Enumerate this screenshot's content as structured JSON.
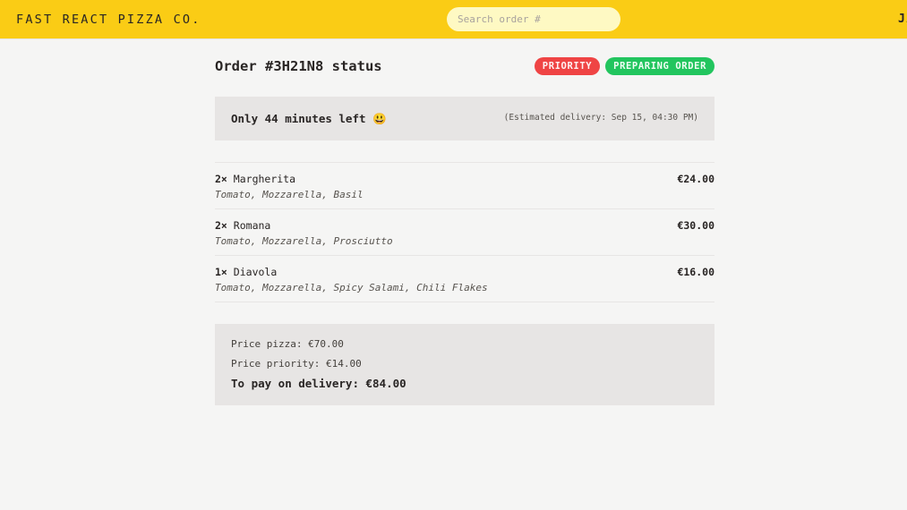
{
  "header": {
    "logo": "FAST REACT PIZZA CO.",
    "search_placeholder": "Search order #",
    "username": "JA"
  },
  "order": {
    "title": "Order #3H21N8 status",
    "badges": {
      "priority": "Priority",
      "status": "Preparing order"
    },
    "eta": {
      "left": "Only 44 minutes left 😃",
      "right": "(Estimated delivery: Sep 15, 04:30 PM)"
    },
    "items": [
      {
        "qty": "2×",
        "name": "Margherita",
        "price": "€24.00",
        "ingredients": "Tomato, Mozzarella, Basil"
      },
      {
        "qty": "2×",
        "name": "Romana",
        "price": "€30.00",
        "ingredients": "Tomato, Mozzarella, Prosciutto"
      },
      {
        "qty": "1×",
        "name": "Diavola",
        "price": "€16.00",
        "ingredients": "Tomato, Mozzarella, Spicy Salami, Chili Flakes"
      }
    ],
    "summary": {
      "price_pizza": "Price pizza: €70.00",
      "price_priority": "Price priority: €14.00",
      "total": "To pay on delivery: €84.00"
    }
  },
  "colors": {
    "header_bg": "#facc15",
    "priority": "#ef4444",
    "status": "#22c55e",
    "panel": "#e7e5e4"
  }
}
